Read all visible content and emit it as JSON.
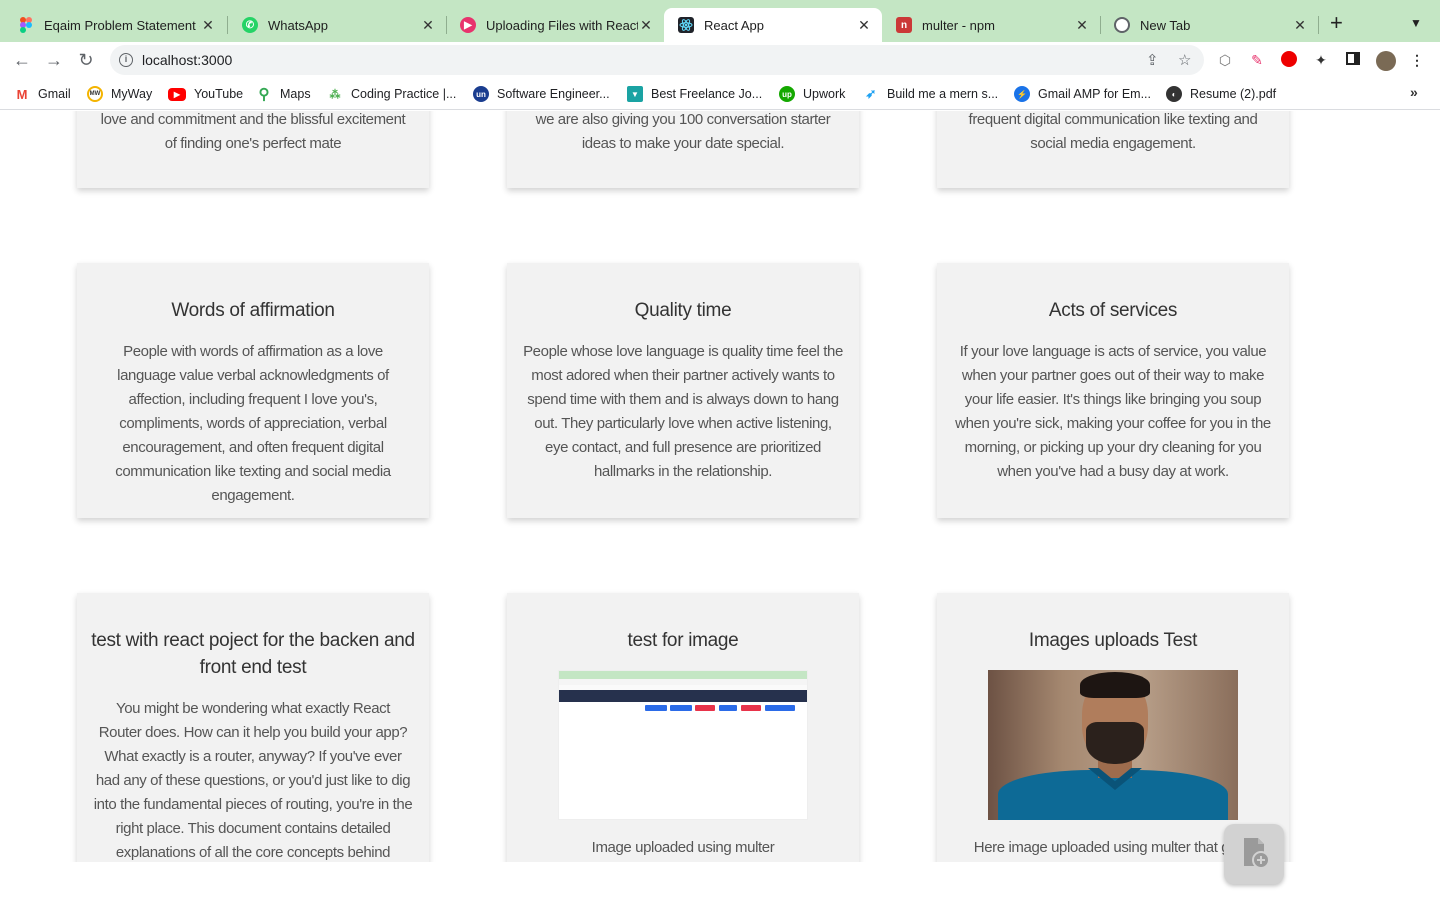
{
  "browser": {
    "tabs": [
      {
        "title": "Eqaim Problem Statement -",
        "favicon": "figma-icon",
        "color": "#f24e1e"
      },
      {
        "title": "WhatsApp",
        "favicon": "whatsapp-icon",
        "color": "#25d366"
      },
      {
        "title": "Uploading Files with React.",
        "favicon": "play-icon",
        "color": "#e8336d"
      },
      {
        "title": "React App",
        "favicon": "react-icon",
        "color": "#20232a",
        "active": true
      },
      {
        "title": "multer - npm",
        "favicon": "npm-icon",
        "color": "#cb3837"
      },
      {
        "title": "New Tab",
        "favicon": "chrome-icon",
        "color": "#5f6368"
      }
    ],
    "address": "localhost:3000",
    "bookmarks": [
      {
        "label": "Gmail",
        "icon": "gmail-icon",
        "color": "#ea4335"
      },
      {
        "label": "MyWay",
        "icon": "myway-icon",
        "color": "#f4b400"
      },
      {
        "label": "YouTube",
        "icon": "youtube-icon",
        "color": "#ff0000"
      },
      {
        "label": "Maps",
        "icon": "maps-icon",
        "color": "#34a853"
      },
      {
        "label": "Coding Practice |...",
        "icon": "coding-icon",
        "color": "#4caf50"
      },
      {
        "label": "Software Engineer...",
        "icon": "un-icon",
        "color": "#1a3d8f"
      },
      {
        "label": "Best Freelance Jo...",
        "icon": "freelance-icon",
        "color": "#1aa3a3"
      },
      {
        "label": "Upwork",
        "icon": "upwork-icon",
        "color": "#14a800"
      },
      {
        "label": "Build me a mern s...",
        "icon": "bird-icon",
        "color": "#1da1f2"
      },
      {
        "label": "Gmail AMP for Em...",
        "icon": "amp-icon",
        "color": "#1a73e8"
      },
      {
        "label": "Resume (2).pdf",
        "icon": "globe-icon",
        "color": "#333333"
      }
    ]
  },
  "cards": [
    {
      "title": "",
      "body": "love and commitment and the blissful excitement of finding one's perfect mate"
    },
    {
      "title": "",
      "body": "we are also giving you 100 conversation starter ideas to make your date special."
    },
    {
      "title": "",
      "body": "frequent digital communication like texting and social media engagement."
    },
    {
      "title": "Words of affirmation",
      "body": "People with words of affirmation as a love language value verbal acknowledgments of affection, including frequent I love you's, compliments, words of appreciation, verbal encouragement, and often frequent digital communication like texting and social media engagement."
    },
    {
      "title": "Quality time",
      "body": "People whose love language is quality time feel the most adored when their partner actively wants to spend time with them and is always down to hang out. They particularly love when active listening, eye contact, and full presence are prioritized hallmarks in the relationship."
    },
    {
      "title": "Acts of services",
      "body": "If your love language is acts of service, you value when your partner goes out of their way to make your life easier. It's things like bringing you soup when you're sick, making your coffee for you in the morning, or picking up your dry cleaning for you when you've had a busy day at work."
    },
    {
      "title": "test with react poject for the backen and front end test",
      "body": "You might be wondering what exactly React Router does. How can it help you build your app? What exactly is a router, anyway? If you've ever had any of these questions, or you'd just like to dig into the fundamental pieces of routing, you're in the right place. This document contains detailed explanations of all the core concepts behind routing as implemented"
    },
    {
      "title": "test for image",
      "body": "Image uploaded using multer"
    },
    {
      "title": "Images uploads Test",
      "body": "Here image uploaded using multer that goes"
    }
  ],
  "fab": {
    "icon": "file-add-icon"
  }
}
